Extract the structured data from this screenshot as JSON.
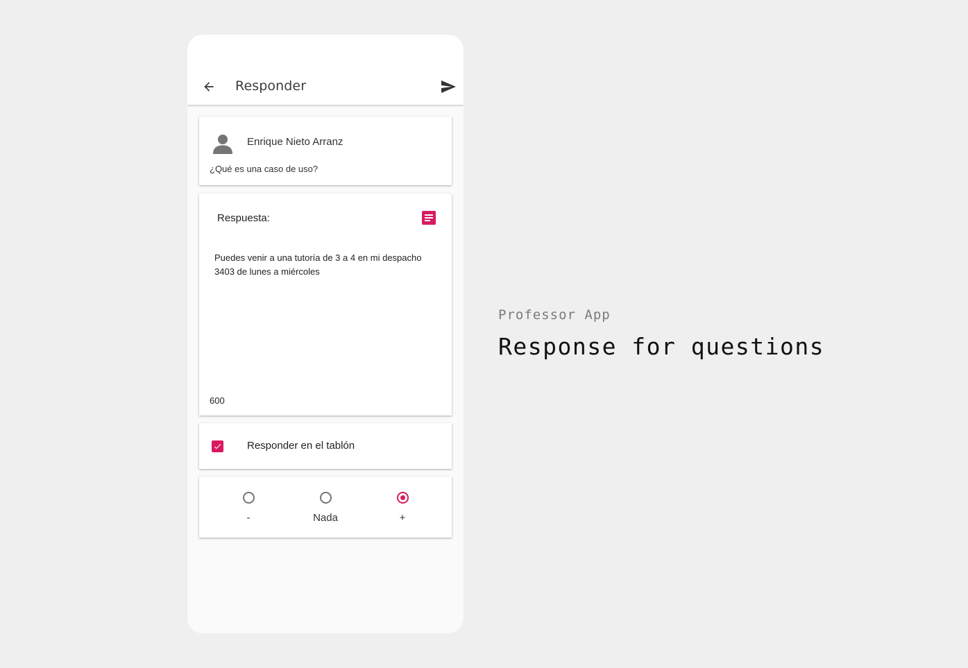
{
  "colors": {
    "accent": "#d81b60",
    "background": "#efefef",
    "surface": "#ffffff",
    "screen": "#fafafa"
  },
  "appbar": {
    "title": "Responder",
    "back_icon": "arrow-left-icon",
    "send_icon": "send-icon"
  },
  "question": {
    "avatar_icon": "person-icon",
    "author": "Enrique Nieto Arranz",
    "text": "¿Qué es una caso de uso?"
  },
  "answer": {
    "label": "Respuesta:",
    "doc_icon": "notes-icon",
    "value": "Puedes venir a una tutoría de 3 a 4 en mi despacho 3403 de lunes a miércoles",
    "char_count": "600"
  },
  "board": {
    "checked": true,
    "label": "Responder en el tablón"
  },
  "rating": {
    "options": [
      {
        "label": "-",
        "selected": false
      },
      {
        "label": "Nada",
        "selected": false
      },
      {
        "label": "+",
        "selected": true
      }
    ]
  },
  "caption": {
    "subtitle": "Professor App",
    "title": "Response for questions"
  }
}
